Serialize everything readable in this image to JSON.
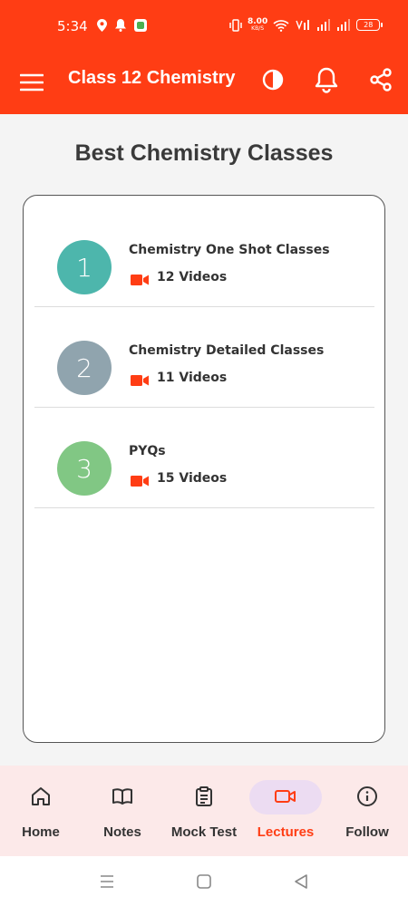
{
  "status_bar": {
    "time": "5:34",
    "net_speed_value": "8.00",
    "net_speed_unit": "KB/S",
    "battery": "28"
  },
  "app_bar": {
    "title": "Class 12 Chemistry",
    "icons": [
      "menu-icon",
      "contrast-icon",
      "bell-icon",
      "share-icon"
    ]
  },
  "page": {
    "heading": "Best Chemistry Classes"
  },
  "list": {
    "items": [
      {
        "number": "1",
        "title": "Chemistry One Shot Classes",
        "count": "12 Videos",
        "color": "#4db6ac"
      },
      {
        "number": "2",
        "title": "Chemistry Detailed Classes",
        "count": "11 Videos",
        "color": "#90a4ae"
      },
      {
        "number": "3",
        "title": "PYQs",
        "count": "15 Videos",
        "color": "#81c784"
      }
    ]
  },
  "bottom_nav": {
    "items": [
      {
        "label": "Home",
        "icon": "home-icon"
      },
      {
        "label": "Notes",
        "icon": "book-icon"
      },
      {
        "label": "Mock Test",
        "icon": "clipboard-icon"
      },
      {
        "label": "Lectures",
        "icon": "video-icon",
        "active": true
      },
      {
        "label": "Follow",
        "icon": "info-icon"
      }
    ]
  },
  "colors": {
    "accent": "#ff3d14",
    "nav_background": "#fce9e9",
    "active_pill": "#ecdcf2"
  }
}
